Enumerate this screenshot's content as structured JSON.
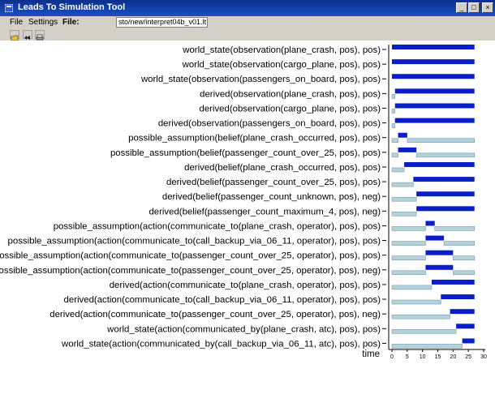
{
  "window": {
    "title": "Leads To Simulation Tool",
    "controls": [
      "_",
      "□",
      "×"
    ]
  },
  "menu": {
    "file": "File",
    "settings": "Settings",
    "file_label": "File:",
    "file_path": "sto/new/interpret04b_v01.lt"
  },
  "toolbar": {
    "icons": [
      "open-folder-icon",
      "rewind-icon",
      "print-icon"
    ]
  },
  "chart_data": {
    "type": "gantt",
    "x_label": "time",
    "x_ticks": [
      0,
      5,
      10,
      15,
      20,
      25,
      30
    ],
    "xlim": [
      0,
      30
    ],
    "colors": {
      "true": "#0a1ec8",
      "false": "#b4d2dc"
    },
    "rows": [
      {
        "label": "world_state(observation(plane_crash, pos), pos)",
        "true": [
          [
            0,
            27
          ]
        ],
        "false": []
      },
      {
        "label": "world_state(observation(cargo_plane, pos), pos)",
        "true": [
          [
            0,
            27
          ]
        ],
        "false": []
      },
      {
        "label": "world_state(observation(passengers_on_board, pos), pos)",
        "true": [
          [
            0,
            27
          ]
        ],
        "false": []
      },
      {
        "label": "derived(observation(plane_crash, pos), pos)",
        "true": [
          [
            1,
            27
          ]
        ],
        "false": [
          [
            0,
            1
          ]
        ]
      },
      {
        "label": "derived(observation(cargo_plane, pos), pos)",
        "true": [
          [
            1,
            27
          ]
        ],
        "false": [
          [
            0,
            1
          ]
        ]
      },
      {
        "label": "derived(observation(passengers_on_board, pos), pos)",
        "true": [
          [
            1,
            27
          ]
        ],
        "false": [
          [
            0,
            1
          ]
        ]
      },
      {
        "label": "possible_assumption(belief(plane_crash_occurred, pos), pos)",
        "true": [
          [
            2,
            5
          ]
        ],
        "false": [
          [
            0,
            2
          ],
          [
            5,
            27
          ]
        ]
      },
      {
        "label": "possible_assumption(belief(passenger_count_over_25, pos), pos)",
        "true": [
          [
            2,
            8
          ]
        ],
        "false": [
          [
            0,
            2
          ],
          [
            8,
            27
          ]
        ]
      },
      {
        "label": "derived(belief(plane_crash_occurred, pos), pos)",
        "true": [
          [
            4,
            27
          ]
        ],
        "false": [
          [
            0,
            4
          ]
        ]
      },
      {
        "label": "derived(belief(passenger_count_over_25, pos), pos)",
        "true": [
          [
            7,
            27
          ]
        ],
        "false": [
          [
            0,
            7
          ]
        ]
      },
      {
        "label": "derived(belief(passenger_count_unknown, pos), neg)",
        "true": [
          [
            8,
            27
          ]
        ],
        "false": [
          [
            0,
            8
          ]
        ]
      },
      {
        "label": "derived(belief(passenger_count_maximum_4, pos), neg)",
        "true": [
          [
            8,
            27
          ]
        ],
        "false": [
          [
            0,
            8
          ]
        ]
      },
      {
        "label": "possible_assumption(action(communicate_to(plane_crash, operator), pos), pos)",
        "true": [
          [
            11,
            14
          ]
        ],
        "false": [
          [
            0,
            11
          ],
          [
            14,
            27
          ]
        ]
      },
      {
        "label": "possible_assumption(action(communicate_to(call_backup_via_06_11, operator), pos), pos)",
        "true": [
          [
            11,
            17
          ]
        ],
        "false": [
          [
            0,
            11
          ],
          [
            17,
            27
          ]
        ]
      },
      {
        "label": "possible_assumption(action(communicate_to(passenger_count_over_25, operator), pos), pos)",
        "true": [
          [
            11,
            20
          ]
        ],
        "false": [
          [
            0,
            11
          ],
          [
            20,
            27
          ]
        ]
      },
      {
        "label": "possible_assumption(action(communicate_to(passenger_count_over_25, operator), pos), neg)",
        "true": [
          [
            11,
            20
          ]
        ],
        "false": [
          [
            0,
            11
          ],
          [
            20,
            27
          ]
        ]
      },
      {
        "label": "derived(action(communicate_to(plane_crash, operator), pos), pos)",
        "true": [
          [
            13,
            27
          ]
        ],
        "false": [
          [
            0,
            13
          ]
        ]
      },
      {
        "label": "derived(action(communicate_to(call_backup_via_06_11, operator), pos), pos)",
        "true": [
          [
            16,
            27
          ]
        ],
        "false": [
          [
            0,
            16
          ]
        ]
      },
      {
        "label": "derived(action(communicate_to(passenger_count_over_25, operator), pos), neg)",
        "true": [
          [
            19,
            27
          ]
        ],
        "false": [
          [
            0,
            19
          ]
        ]
      },
      {
        "label": "world_state(action(communicated_by(plane_crash, atc), pos), pos)",
        "true": [
          [
            21,
            27
          ]
        ],
        "false": [
          [
            0,
            21
          ]
        ]
      },
      {
        "label": "world_state(action(communicated_by(call_backup_via_06_11, atc), pos), pos)",
        "true": [
          [
            23,
            27
          ]
        ],
        "false": [
          [
            0,
            23
          ]
        ]
      }
    ]
  }
}
